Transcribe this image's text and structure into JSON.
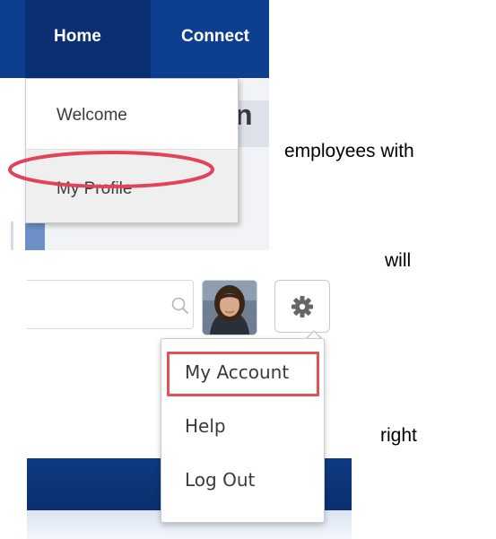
{
  "top_nav": {
    "home_label": "Home",
    "connect_label": "Connect",
    "page_title_fragment": "n"
  },
  "home_dropdown": {
    "items": [
      {
        "label": "Welcome"
      },
      {
        "label": "My Profile",
        "highlighted": true
      }
    ]
  },
  "header_controls": {
    "search": {
      "value": "",
      "placeholder": ""
    },
    "avatar_icon": "user-avatar-photo",
    "settings_icon": "gear-icon"
  },
  "account_menu": {
    "items": [
      {
        "label": "My Account",
        "highlighted": true
      },
      {
        "label": "Help"
      },
      {
        "label": "Log Out"
      }
    ]
  },
  "captions": [
    "employees with",
    "will",
    "right"
  ],
  "colors": {
    "nav_blue": "#0e3e8e",
    "nav_active_blue": "#0a2f73",
    "highlight_red": "#e0435a"
  }
}
